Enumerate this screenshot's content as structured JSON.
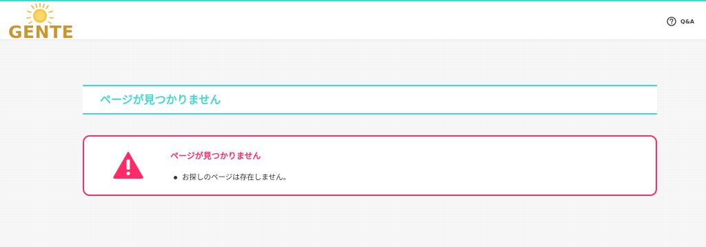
{
  "header": {
    "logo_text": "GENTE",
    "qa_label": "Q&A"
  },
  "page": {
    "title": "ページが見つかりません"
  },
  "alert": {
    "title": "ページが見つかりません",
    "items": [
      "お探しのページは存在しません。"
    ]
  },
  "colors": {
    "accent": "#3fd8cf",
    "error": "#ff2b69",
    "logo_gold": "#c9962f"
  }
}
